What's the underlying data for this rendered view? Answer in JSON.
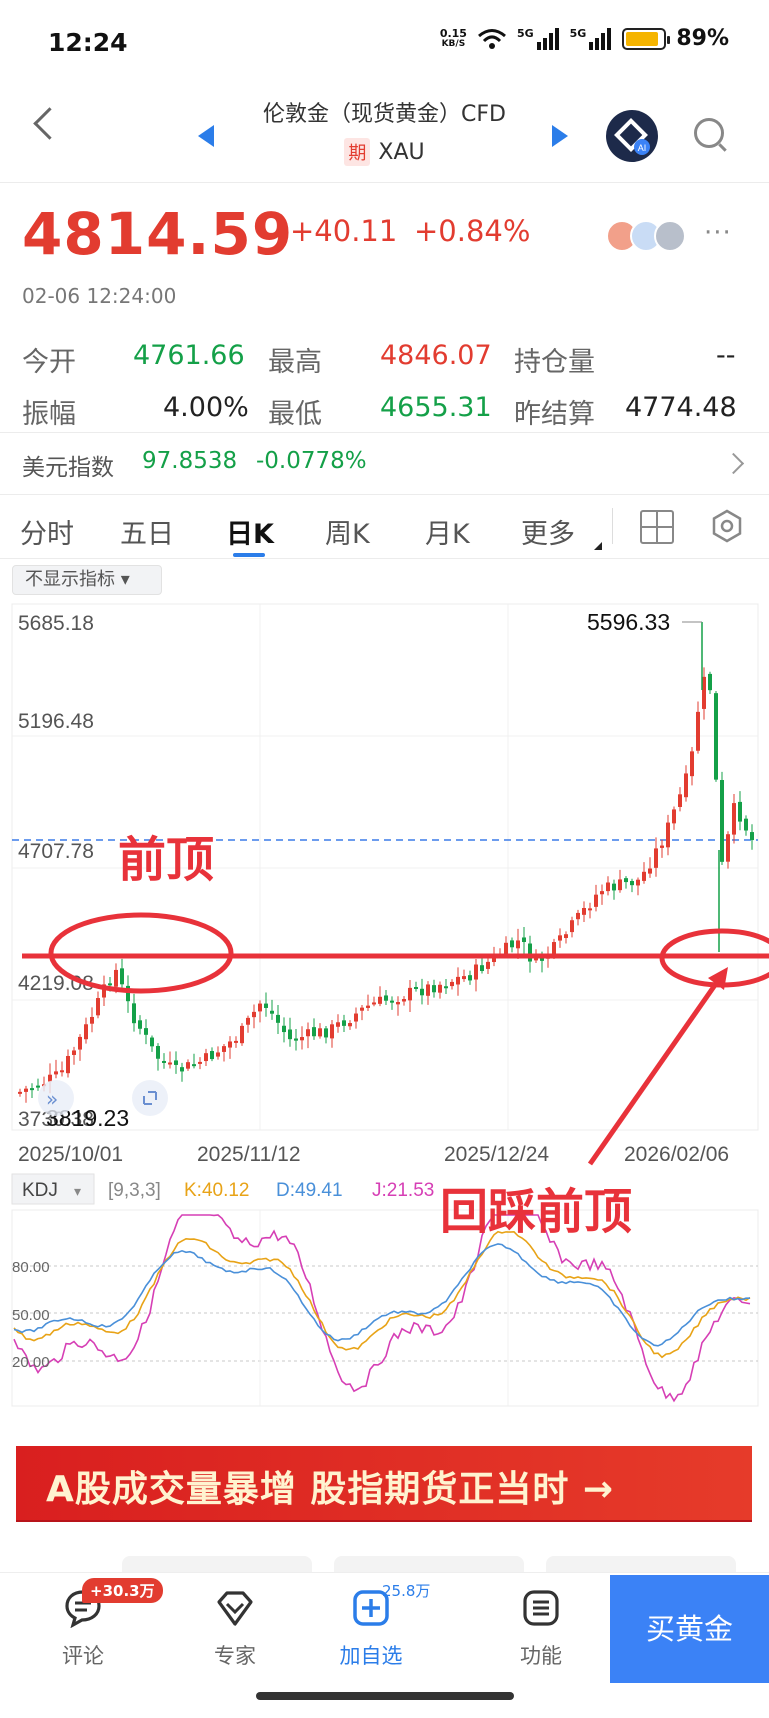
{
  "status_bar": {
    "time": "12:24",
    "net_speed_value": "0.15",
    "net_speed_unit": "KB/S",
    "signal1": "5G",
    "signal2": "5G",
    "battery_pct_text": "89%",
    "battery_level": 0.89,
    "battery_color": "#f5b400"
  },
  "header": {
    "title": "伦敦金（现货黄金）CFD",
    "tag": "期",
    "symbol": "XAU",
    "ai_label": "AI",
    "icons": [
      "back-icon",
      "prev-triangle-icon",
      "next-triangle-icon",
      "ai-assistant-icon",
      "search-icon"
    ]
  },
  "quote": {
    "price": "4814.59",
    "change": "+40.11",
    "change_pct": "+0.84%",
    "datetime": "02-06 12:24:00",
    "more": "···"
  },
  "stats": {
    "open_label": "今开",
    "open": "4761.66",
    "high_label": "最高",
    "high": "4846.07",
    "oi_label": "持仓量",
    "oi": "--",
    "amp_label": "振幅",
    "amp": "4.00%",
    "low_label": "最低",
    "low": "4655.31",
    "prev_label": "昨结算",
    "prev": "4774.48"
  },
  "usd_index": {
    "label": "美元指数",
    "value": "97.8538",
    "change": "-0.0778%"
  },
  "tabs": [
    {
      "label": "分时"
    },
    {
      "label": "五日"
    },
    {
      "label": "日K"
    },
    {
      "label": "周K"
    },
    {
      "label": "月K"
    },
    {
      "label": "更多"
    }
  ],
  "indicator_toggle": "不显示指标",
  "kline": {
    "y_labels": [
      "5685.18",
      "5196.48",
      "4707.78",
      "4219.08"
    ],
    "y_bottom_label": "3730.38",
    "min_label": "3819.23",
    "max_label": "5596.33",
    "dates": [
      "2025/10/01",
      "2025/11/12",
      "2025/12/24",
      "2026/02/06"
    ],
    "annotation_top": "前顶",
    "annotation_bottom": "回踩前顶",
    "colors": {
      "up": "#e23c30",
      "down": "#14a048",
      "dash": "#3b7be8",
      "annot": "#e8323a"
    }
  },
  "kdj": {
    "label": "KDJ",
    "params": "[9,3,3]",
    "k_text": "K:40.12",
    "d_text": "D:49.41",
    "j_text": "J:21.53",
    "y_labels": [
      "80.00",
      "50.00",
      "20.00"
    ],
    "colors": {
      "k": "#e8a317",
      "d": "#4a90d9",
      "j": "#d63fb5"
    }
  },
  "banner": {
    "text": "A股成交量暴增 股指期货正当时 →"
  },
  "bottom_bar": {
    "comment_label": "评论",
    "comment_badge": "+30.3万",
    "expert_label": "专家",
    "add_label": "加自选",
    "add_badge": "25.8万",
    "func_label": "功能",
    "buy_label": "买黄金"
  }
}
